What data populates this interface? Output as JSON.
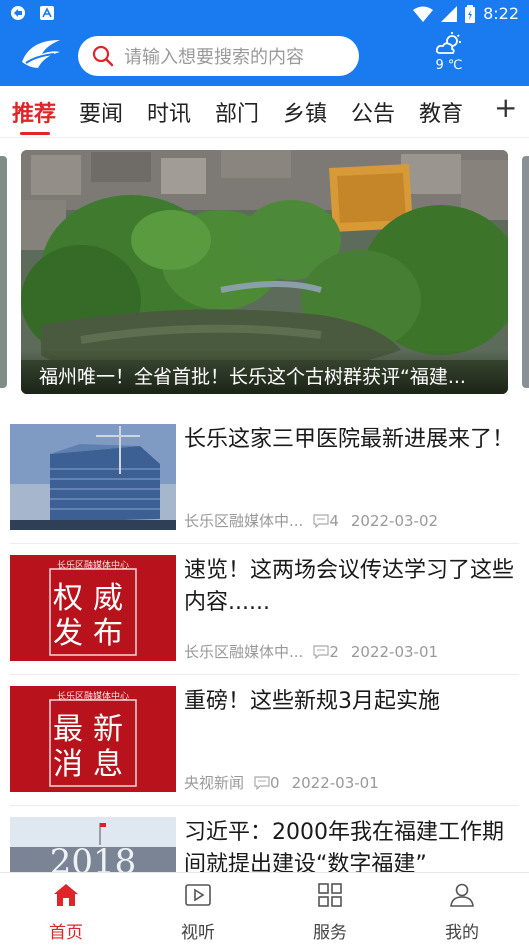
{
  "status_bar": {
    "time": "8:22"
  },
  "header": {
    "search_placeholder": "请输入想要搜索的内容",
    "weather_temp": "9 ℃"
  },
  "tabs": [
    {
      "label": "推荐",
      "active": true
    },
    {
      "label": "要闻"
    },
    {
      "label": "时讯"
    },
    {
      "label": "部门"
    },
    {
      "label": "乡镇"
    },
    {
      "label": "公告"
    },
    {
      "label": "教育"
    }
  ],
  "tab_add": "+",
  "banner": {
    "caption": "福州唯一！全省首批！长乐这个古树群获评“福建..."
  },
  "articles": [
    {
      "title": "长乐这家三甲医院最新进展来了！",
      "source": "长乐区融媒体中...",
      "comments": "4",
      "date": "2022-03-02"
    },
    {
      "title": "速览！这两场会议传达学习了这些内容......",
      "source": "长乐区融媒体中...",
      "comments": "2",
      "date": "2022-03-01",
      "thumb_small": "长乐区融媒体中心",
      "thumb_big1": "权威",
      "thumb_big2": "发布"
    },
    {
      "title": "重磅！这些新规3月起实施",
      "source": "央视新闻",
      "comments": "0",
      "date": "2022-03-01",
      "thumb_small": "长乐区融媒体中心",
      "thumb_big1": "最新",
      "thumb_big2": "消息"
    },
    {
      "title": "习近平：2000年我在福建工作期间就提出建设“数字福建”",
      "thumb_text": "2018"
    }
  ],
  "bottom_nav": [
    {
      "label": "首页",
      "icon": "home-icon",
      "active": true
    },
    {
      "label": "视听",
      "icon": "video-icon"
    },
    {
      "label": "服务",
      "icon": "grid-icon"
    },
    {
      "label": "我的",
      "icon": "user-icon"
    }
  ],
  "colors": {
    "brand_blue": "#1a7af0",
    "accent_red": "#e0242a"
  }
}
